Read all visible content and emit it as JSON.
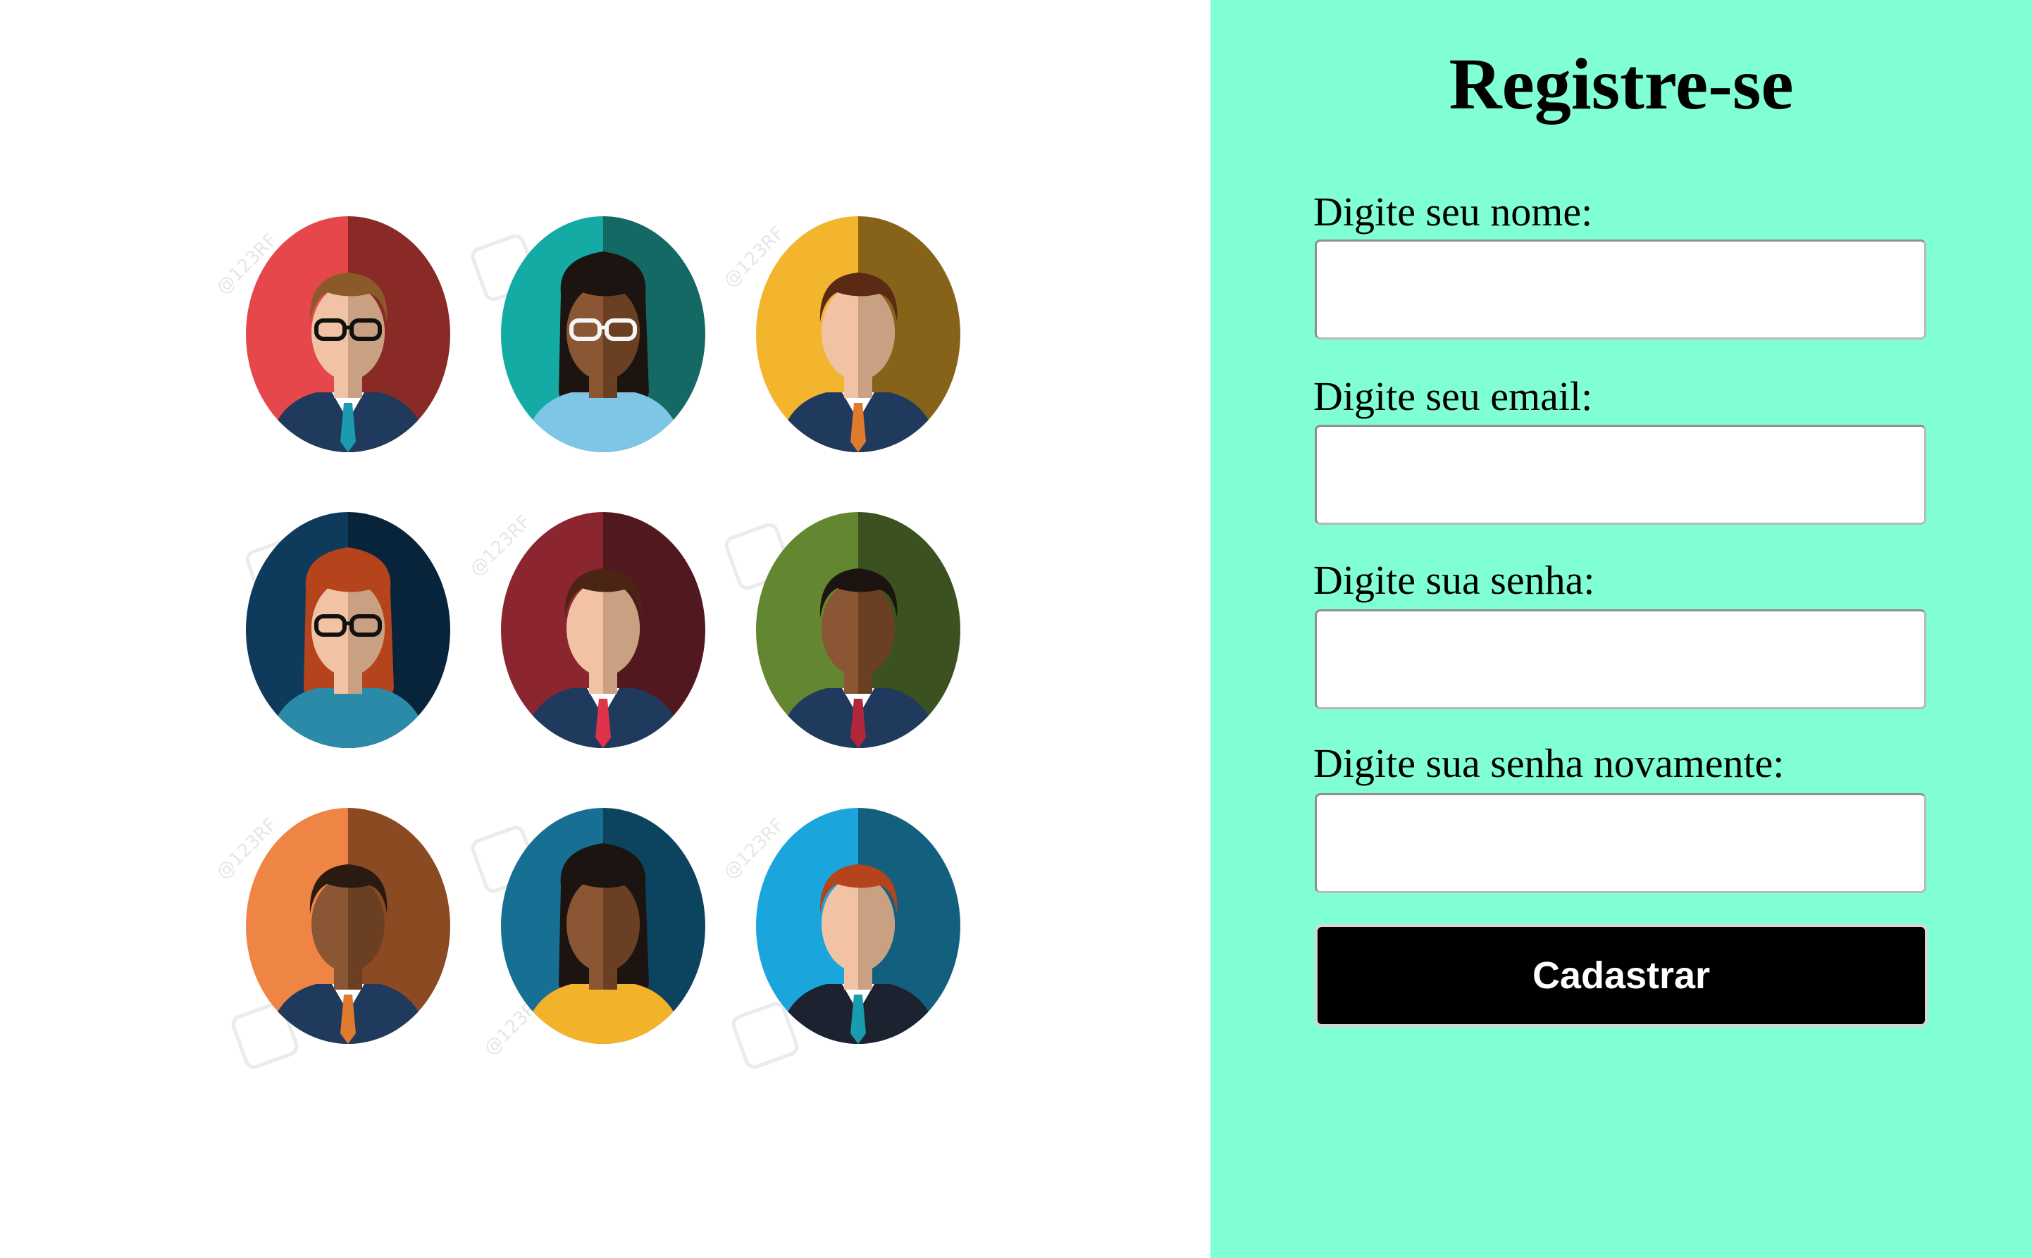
{
  "illustration": {
    "watermark_text": "@123RF",
    "avatars": [
      {
        "name": "avatar-man-glasses-red",
        "bg": "#e5474b",
        "bg_dark": "#8a2a26",
        "skin": "#f1c3a4",
        "skin_dark": "#caa083",
        "hair": "#8a5a2b",
        "top": "#1f3a5c",
        "tie": "#1b9bb0",
        "glasses": true,
        "gender": "male"
      },
      {
        "name": "avatar-woman-glasses-teal",
        "bg": "#14aba4",
        "bg_dark": "#146964",
        "skin": "#8a5633",
        "skin_dark": "#6b3f22",
        "hair": "#1c1411",
        "top": "#7fc6e6",
        "tie": "",
        "glasses": true,
        "gender": "female"
      },
      {
        "name": "avatar-man-yellow",
        "bg": "#f3b52e",
        "bg_dark": "#866318",
        "skin": "#f1c3a4",
        "skin_dark": "#caa083",
        "hair": "#5a2a14",
        "top": "#1f3a5c",
        "tie": "#e07a2c",
        "glasses": false,
        "gender": "male"
      },
      {
        "name": "avatar-woman-glasses-navy",
        "bg": "#0e3a5c",
        "bg_dark": "#08243a",
        "skin": "#f1c3a4",
        "skin_dark": "#caa083",
        "hair": "#b5441c",
        "top": "#2a8aa8",
        "tie": "",
        "glasses": true,
        "gender": "female"
      },
      {
        "name": "avatar-man-maroon",
        "bg": "#8b2631",
        "bg_dark": "#521820",
        "skin": "#f1c3a4",
        "skin_dark": "#caa083",
        "hair": "#4a2514",
        "top": "#1f3a5c",
        "tie": "#e0324a",
        "glasses": false,
        "gender": "male"
      },
      {
        "name": "avatar-man-green",
        "bg": "#638730",
        "bg_dark": "#3b5220",
        "skin": "#8a5633",
        "skin_dark": "#6b3f22",
        "hair": "#1c1411",
        "top": "#1f3a5c",
        "tie": "#b0273a",
        "glasses": false,
        "gender": "male"
      },
      {
        "name": "avatar-man-orange",
        "bg": "#ef8545",
        "bg_dark": "#8c4a22",
        "skin": "#8a5633",
        "skin_dark": "#6b3f22",
        "hair": "#2a1a12",
        "top": "#1f3a5c",
        "tie": "#e07a2c",
        "glasses": false,
        "gender": "male"
      },
      {
        "name": "avatar-woman-blue",
        "bg": "#176f93",
        "bg_dark": "#0c4460",
        "skin": "#8a5633",
        "skin_dark": "#6b3f22",
        "hair": "#1c1411",
        "top": "#f2b32a",
        "tie": "",
        "glasses": false,
        "gender": "female"
      },
      {
        "name": "avatar-man-lightblue",
        "bg": "#1aa6dc",
        "bg_dark": "#13607e",
        "skin": "#f1c3a4",
        "skin_dark": "#caa083",
        "hair": "#b5441c",
        "top": "#1d2230",
        "tie": "#1b9bb0",
        "glasses": false,
        "gender": "male"
      }
    ]
  },
  "form": {
    "title": "Registre-se",
    "name_label": "Digite seu nome:",
    "name_value": "",
    "email_label": "Digite seu email:",
    "email_value": "",
    "password_label": "Digite sua senha:",
    "password_value": "",
    "confirm_label": "Digite sua senha novamente:",
    "confirm_value": "",
    "submit_label": "Cadastrar"
  },
  "colors": {
    "panel_bg": "#80ffd4",
    "button_bg": "#000000",
    "button_text": "#ffffff"
  }
}
